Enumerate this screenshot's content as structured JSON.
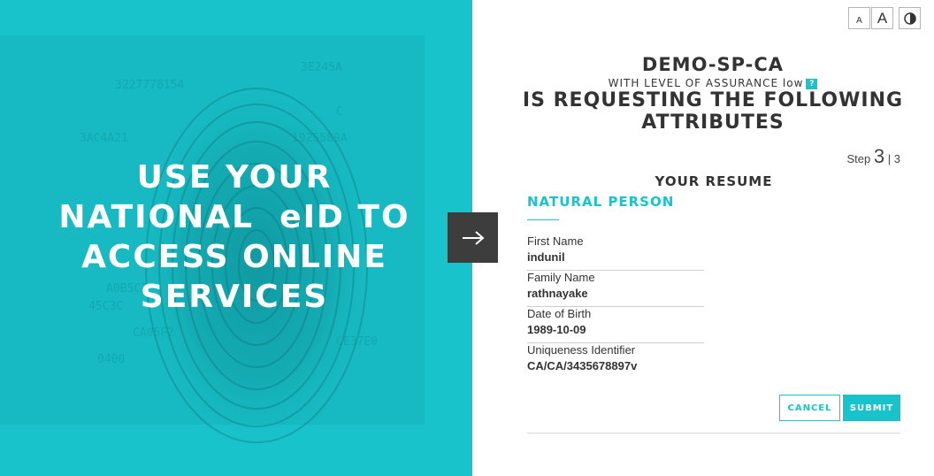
{
  "hero": {
    "lines": [
      "USE YOUR",
      "NATIONAL  eID TO",
      "ACCESS ONLINE",
      "SERVICES"
    ]
  },
  "controls": {
    "small_font": "A",
    "large_font": "A",
    "contrast_icon": "contrast-icon"
  },
  "request": {
    "sp_name": "DEMO-SP-CA",
    "loa_text": "WITH LEVEL OF ASSURANCE low",
    "loa_help": "?",
    "title_line1": "IS REQUESTING THE FOLLOWING",
    "title_line2": "ATTRIBUTES"
  },
  "step": {
    "label": "Step",
    "current": "3",
    "separator": "|",
    "total": "3"
  },
  "resume": {
    "title": "YOUR RESUME",
    "subtitle": "NATURAL PERSON",
    "attributes": [
      {
        "label": "First Name",
        "value": "indunil"
      },
      {
        "label": "Family Name",
        "value": "rathnayake"
      },
      {
        "label": "Date of Birth",
        "value": "1989-10-09"
      },
      {
        "label": "Uniqueness Identifier",
        "value": "CA/CA/3435678897v"
      }
    ]
  },
  "actions": {
    "cancel_label": "CANCEL",
    "submit_label": "SUBMIT"
  },
  "colors": {
    "accent": "#19c3cb",
    "arrow_bg": "#3d3d3d"
  }
}
